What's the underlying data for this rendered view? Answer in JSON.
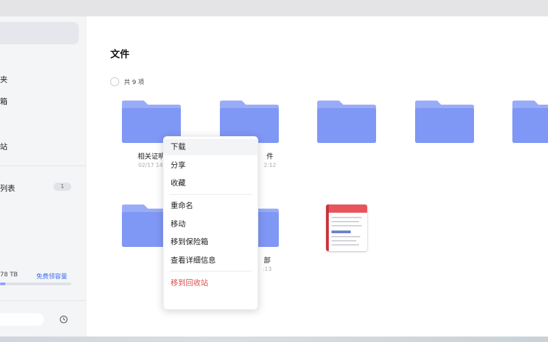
{
  "page": {
    "title": "文件",
    "count_text": "共 9 项"
  },
  "sidebar": {
    "items": [
      {
        "label": "夹"
      },
      {
        "label": "箱"
      },
      {
        "label": "站"
      },
      {
        "label": "列表",
        "badge": "1"
      }
    ],
    "storage": {
      "used_text": "78 TB",
      "upgrade_link": "免费领容量",
      "used_fraction": 0.08
    },
    "search_placeholder": ""
  },
  "files": [
    {
      "name": "相关证明",
      "date": "02/17 14:",
      "type": "folder"
    },
    {
      "name": "件",
      "date": "2:12",
      "type": "folder"
    },
    {
      "name": "",
      "date": "",
      "type": "folder"
    },
    {
      "name": "",
      "date": "",
      "type": "folder"
    },
    {
      "name": "",
      "date": "",
      "type": "folder"
    },
    {
      "name": "",
      "date": "",
      "type": "folder"
    },
    {
      "name": "部",
      "date": ":13",
      "type": "folder"
    },
    {
      "name": "",
      "date": "",
      "type": "document"
    }
  ],
  "context_menu": {
    "items": [
      {
        "label": "下载"
      },
      {
        "label": "分享"
      },
      {
        "label": "收藏"
      },
      {
        "label": "重命名"
      },
      {
        "label": "移动"
      },
      {
        "label": "移到保险箱"
      },
      {
        "label": "查看详细信息"
      },
      {
        "label": "移到回收站"
      }
    ]
  },
  "colors": {
    "accent": "#3b6cf0",
    "folder": "#7f97f5",
    "danger": "#d9534f"
  }
}
